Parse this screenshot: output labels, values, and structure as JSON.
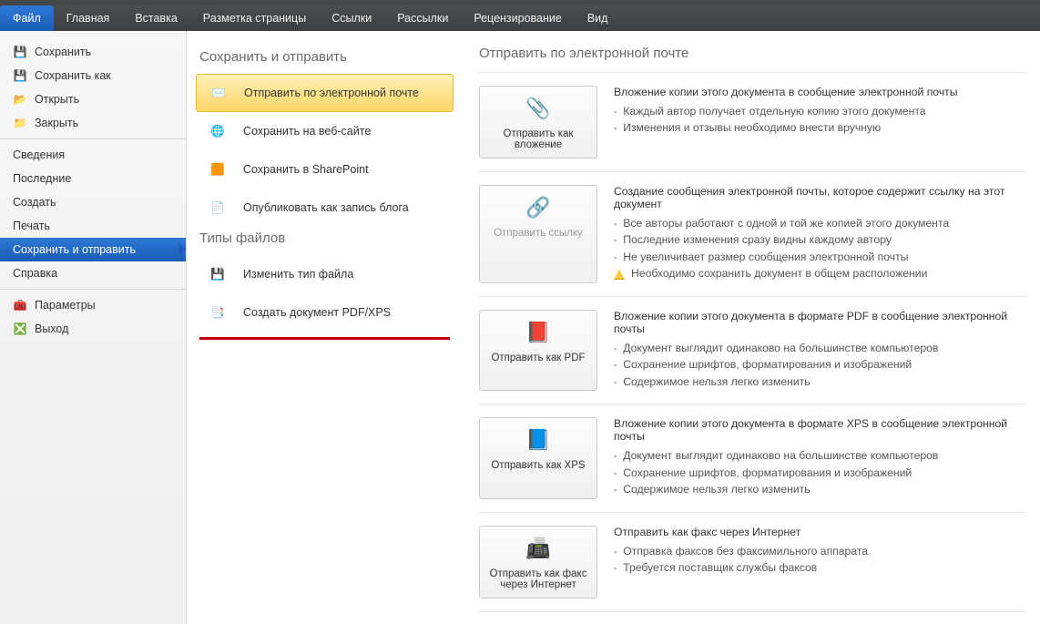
{
  "ribbon": {
    "tabs": [
      "Файл",
      "Главная",
      "Вставка",
      "Разметка страницы",
      "Ссылки",
      "Рассылки",
      "Рецензирование",
      "Вид"
    ]
  },
  "sidebar": {
    "items_top": [
      {
        "label": "Сохранить",
        "icon": "💾"
      },
      {
        "label": "Сохранить как",
        "icon": "💾"
      },
      {
        "label": "Открыть",
        "icon": "📂"
      },
      {
        "label": "Закрыть",
        "icon": "📁"
      }
    ],
    "items_mid": [
      {
        "label": "Сведения"
      },
      {
        "label": "Последние"
      },
      {
        "label": "Создать"
      },
      {
        "label": "Печать"
      },
      {
        "label": "Сохранить и отправить",
        "selected": true
      },
      {
        "label": "Справка"
      }
    ],
    "items_bot": [
      {
        "label": "Параметры",
        "icon": "🧰"
      },
      {
        "label": "Выход",
        "icon": "❎"
      }
    ]
  },
  "middle": {
    "section1_title": "Сохранить и отправить",
    "section1_items": [
      {
        "label": "Отправить по электронной почте",
        "icon": "✉️",
        "selected": true
      },
      {
        "label": "Сохранить на веб-сайте",
        "icon": "🌐"
      },
      {
        "label": "Сохранить в SharePoint",
        "icon": "🟧"
      },
      {
        "label": "Опубликовать как запись блога",
        "icon": "📄"
      }
    ],
    "section2_title": "Типы файлов",
    "section2_items": [
      {
        "label": "Изменить тип файла",
        "icon": "💾"
      },
      {
        "label": "Создать документ PDF/XPS",
        "icon": "📑"
      }
    ]
  },
  "right": {
    "title": "Отправить по электронной почте",
    "items": [
      {
        "btn": "Отправить как вложение",
        "icon": "📎",
        "disabled": false,
        "head": "Вложение копии этого документа в сообщение электронной почты",
        "bullets": [
          "Каждый автор получает отдельную копию этого документа",
          "Изменения и отзывы необходимо внести вручную"
        ]
      },
      {
        "btn": "Отправить ссылку",
        "icon": "🔗",
        "disabled": true,
        "head": "Создание сообщения электронной почты, которое содержит ссылку на этот документ",
        "bullets": [
          "Все авторы работают с одной и той же копией этого документа",
          "Последние изменения сразу видны каждому автору",
          "Не увеличивает размер сообщения электронной почты"
        ],
        "warn": "Необходимо сохранить документ в общем расположении"
      },
      {
        "btn": "Отправить как PDF",
        "icon": "📕",
        "disabled": false,
        "head": "Вложение копии этого документа в формате PDF в сообщение электронной почты",
        "bullets": [
          "Документ выглядит одинаково на большинстве компьютеров",
          "Сохранение шрифтов, форматирования и изображений",
          "Содержимое нельзя легко изменить"
        ]
      },
      {
        "btn": "Отправить как XPS",
        "icon": "📘",
        "disabled": false,
        "head": "Вложение копии этого документа в формате XPS в сообщение электронной почты",
        "bullets": [
          "Документ выглядит одинаково на большинстве компьютеров",
          "Сохранение шрифтов, форматирования и изображений",
          "Содержимое нельзя легко изменить"
        ]
      },
      {
        "btn": "Отправить как факс через Интернет",
        "icon": "📠",
        "disabled": false,
        "head": "Отправить как факс через Интернет",
        "bullets": [
          "Отправка факсов без факсимильного аппарата",
          "Требуется поставщик службы факсов"
        ]
      }
    ]
  }
}
